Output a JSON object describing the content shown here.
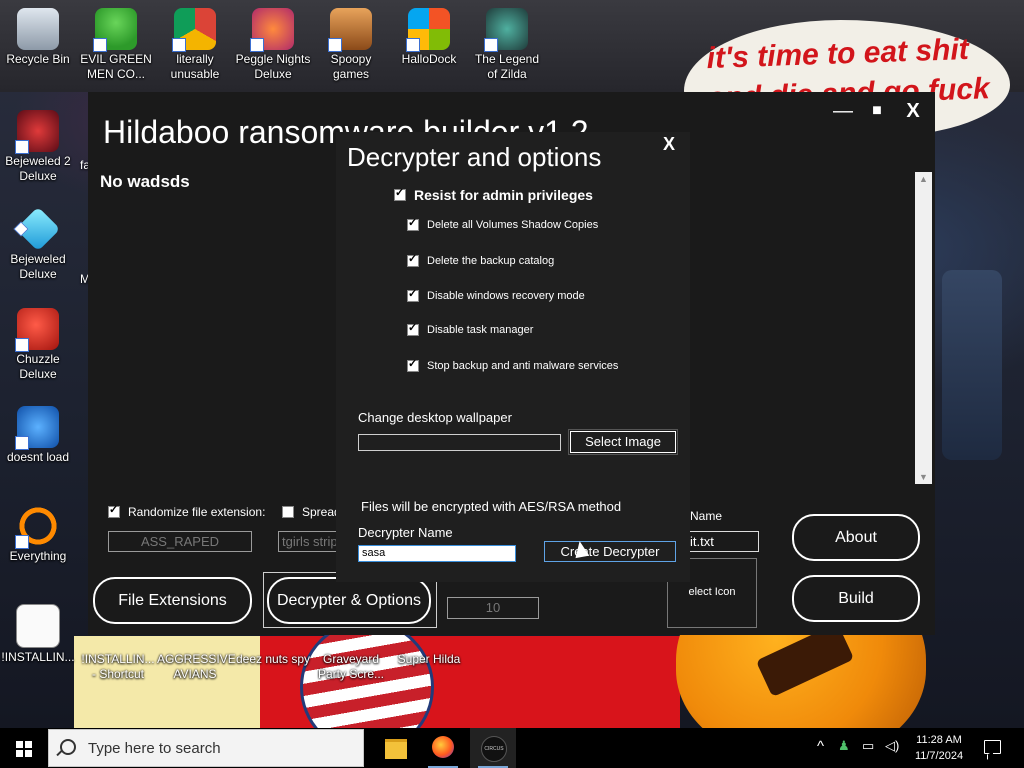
{
  "wallpaper": {
    "speech_text": "it's time to eat shit and die and go fuck !"
  },
  "desktop_icons": [
    {
      "label": "Recycle Bin",
      "icon": "recycle-bin-icon"
    },
    {
      "label": "EVIL GREEN MEN CO...",
      "icon": "green-men-icon"
    },
    {
      "label": "literally unusable",
      "icon": "chrome-icon"
    },
    {
      "label": "Peggle Nights Deluxe",
      "icon": "peggle-icon"
    },
    {
      "label": "Spoopy games",
      "icon": "folder-icon"
    },
    {
      "label": "HalloDock",
      "icon": "hallodock-icon"
    },
    {
      "label": "The Legend of Zilda",
      "icon": "zilda-icon"
    },
    {
      "label": "Bejeweled 2 Deluxe",
      "icon": "bejeweled2-icon"
    },
    {
      "label": "Bejeweled Deluxe",
      "icon": "bejeweled-icon"
    },
    {
      "label": "Chuzzle Deluxe",
      "icon": "chuzzle-icon"
    },
    {
      "label": "doesnt load",
      "icon": "thunderbird-icon"
    },
    {
      "label": "Everything",
      "icon": "everything-icon"
    },
    {
      "label": "!INSTALLIN...",
      "icon": "document-icon"
    },
    {
      "label": "!INSTALLIN... - Shortcut",
      "icon": "document-icon"
    },
    {
      "label": "AGGRESSIVE AVIANS",
      "icon": "game-icon"
    },
    {
      "label": "deez nuts spy",
      "icon": "game-icon"
    },
    {
      "label": "Graveyard Party Scre...",
      "icon": "game-icon"
    },
    {
      "label": "Super Hilda",
      "icon": "game-icon"
    }
  ],
  "partial_labels": {
    "fa": "fa",
    "m": "M"
  },
  "main_window": {
    "title": "Hildaboo ransomware builder v1.2",
    "minimize": "—",
    "maximize": "■",
    "close": "X",
    "subtitle": "No wadsds",
    "randomize_label": "Randomize file extension:",
    "randomize_checked": true,
    "randomize_value": "ASS_RAPED",
    "spread_label": "Spread",
    "spread_checked": false,
    "spread_value": "tgirls strip",
    "name_label": "Name",
    "name_value": "it.txt",
    "select_icon_label": "elect Icon",
    "number_value": "10",
    "file_extensions_button": "File Extensions",
    "decrypter_options_button": "Decrypter & Options",
    "about_button": "About",
    "build_button": "Build"
  },
  "dialog": {
    "title": "Decrypter and options",
    "close": "X",
    "resist_admin": {
      "label": "Resist for admin privileges",
      "checked": true
    },
    "options": [
      {
        "label": "Delete all Volumes Shadow Copies",
        "checked": true
      },
      {
        "label": "Delete the backup catalog",
        "checked": true
      },
      {
        "label": "Disable windows recovery mode",
        "checked": true
      },
      {
        "label": "Disable task manager",
        "checked": true
      },
      {
        "label": "Stop backup and anti malware services",
        "checked": true
      }
    ],
    "wallpaper_label": "Change desktop wallpaper",
    "wallpaper_value": "",
    "select_image_button": "Select Image",
    "encryption_note": "Files will be encrypted with AES/RSA method",
    "decrypter_name_label": "Decrypter Name",
    "decrypter_name_value": "sasa",
    "create_decrypter_button": "Create Decrypter"
  },
  "taskbar": {
    "search_placeholder": "Type here to search",
    "app3_label": "CIRCUS",
    "tray_chevron": "^",
    "time": "11:28 AM",
    "date": "11/7/2024"
  }
}
